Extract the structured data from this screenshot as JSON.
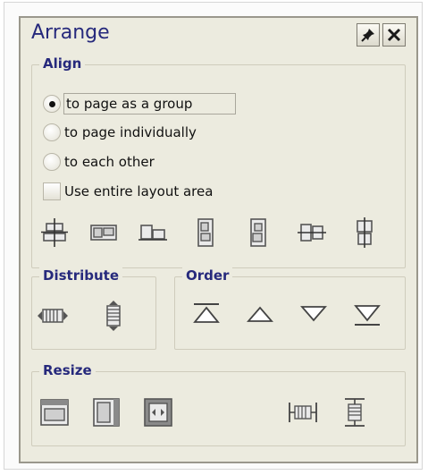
{
  "panel": {
    "title": "Arrange",
    "pin_icon": "pushpin-icon",
    "close_icon": "close-icon"
  },
  "align": {
    "legend": "Align",
    "options": [
      {
        "label": "to page as a group",
        "selected": true
      },
      {
        "label": "to page individually",
        "selected": false
      },
      {
        "label": "to each other",
        "selected": false
      }
    ],
    "use_entire_layout_area": {
      "label": "Use entire layout area",
      "checked": false
    },
    "buttons": [
      "align-center-icon",
      "align-left-icon",
      "align-bottom-icon",
      "align-top-stack-icon",
      "align-bottom-stack-icon",
      "align-middle-horizontal-icon",
      "align-middle-vertical-icon"
    ]
  },
  "distribute": {
    "legend": "Distribute",
    "buttons": [
      "distribute-horizontally-icon",
      "distribute-vertically-icon"
    ]
  },
  "order": {
    "legend": "Order",
    "buttons": [
      "bring-to-front-icon",
      "bring-forward-icon",
      "send-backward-icon",
      "send-to-back-icon"
    ]
  },
  "resize": {
    "legend": "Resize",
    "buttons": [
      "resize-same-width-icon",
      "resize-same-height-icon",
      "resize-same-size-icon",
      "fit-width-icon",
      "fit-height-icon"
    ]
  },
  "colors": {
    "panel_bg": "#ecebdf",
    "title": "#26297c",
    "legend": "#26297c"
  }
}
